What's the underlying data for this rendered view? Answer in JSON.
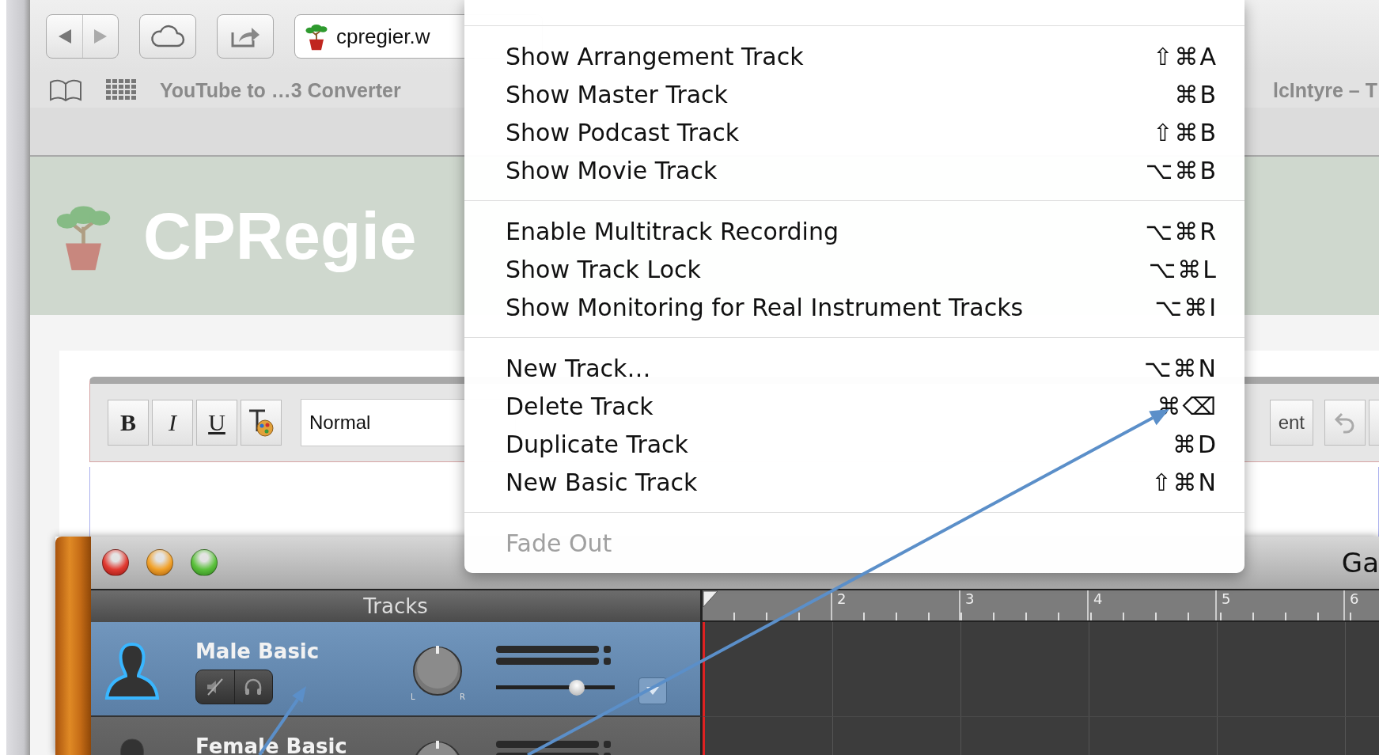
{
  "browser": {
    "url": "cpregier.w",
    "bookmarks": [
      {
        "label": "YouTube to …3 Converter"
      },
      {
        "label": "lcIntyre – T"
      }
    ],
    "site_title": "CPRegie",
    "editor": {
      "format_buttons": [
        {
          "label": "B",
          "kind": "bold"
        },
        {
          "label": "I",
          "kind": "italic"
        },
        {
          "label": "U",
          "kind": "underline"
        }
      ],
      "style": "Normal",
      "partial_button": "ent"
    }
  },
  "menu": {
    "groups": [
      {
        "items": [
          {
            "label": "Show Arrangement Track",
            "shortcut": "⇧⌘A",
            "disabled": false
          },
          {
            "label": "Show Master Track",
            "shortcut": "⌘B",
            "disabled": false
          },
          {
            "label": "Show Podcast Track",
            "shortcut": "⇧⌘B",
            "disabled": false
          },
          {
            "label": "Show Movie Track",
            "shortcut": "⌥⌘B",
            "disabled": false
          }
        ]
      },
      {
        "items": [
          {
            "label": "Enable Multitrack Recording",
            "shortcut": "⌥⌘R",
            "disabled": false
          },
          {
            "label": "Show Track Lock",
            "shortcut": "⌥⌘L",
            "disabled": false
          },
          {
            "label": "Show Monitoring for Real Instrument Tracks",
            "shortcut": "⌥⌘I",
            "disabled": false
          }
        ]
      },
      {
        "items": [
          {
            "label": "New Track…",
            "shortcut": "⌥⌘N",
            "disabled": false
          },
          {
            "label": "Delete Track",
            "shortcut": "⌘⌫",
            "disabled": false
          },
          {
            "label": "Duplicate Track",
            "shortcut": "⌘D",
            "disabled": false
          },
          {
            "label": "New Basic Track",
            "shortcut": "⇧⌘N",
            "disabled": false
          }
        ]
      },
      {
        "items": [
          {
            "label": "Fade Out",
            "disabled": true
          }
        ]
      }
    ]
  },
  "garageband": {
    "title": "Ga",
    "tracks_header": "Tracks",
    "ruler": [
      "2",
      "3",
      "4",
      "5",
      "6"
    ],
    "tracks": [
      {
        "name": "Male Basic",
        "selected": true,
        "level": 0.68,
        "pan_left": "L",
        "pan_right": "R"
      },
      {
        "name": "Female Basic",
        "selected": false
      }
    ]
  }
}
